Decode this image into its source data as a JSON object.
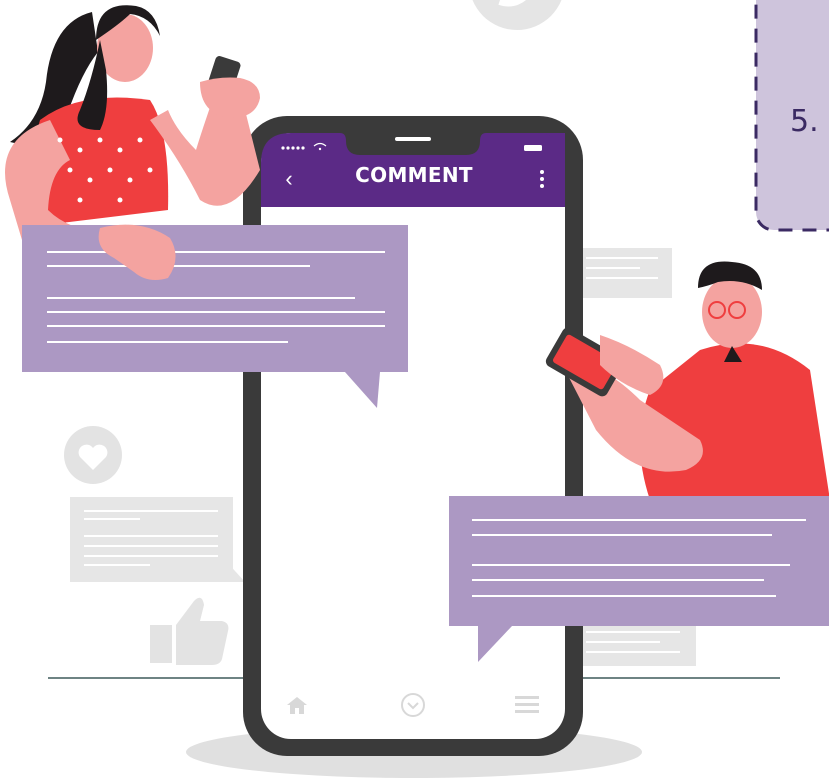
{
  "phone": {
    "header_title": "COMMENT",
    "back_icon": "chevron-left-icon",
    "menu_icon": "vertical-dots-icon",
    "bottom_nav": [
      "home-icon",
      "chevron-circle-icon",
      "hamburger-icon"
    ]
  },
  "step": {
    "label": "5."
  },
  "colors": {
    "header_purple": "#5b2a86",
    "bubble_purple": "#ac98c3",
    "phone_frame": "#3a3a3a",
    "shirt_red": "#ef3e3f",
    "skin": "#f4a3a0",
    "hair": "#1e1a1c",
    "gray_bubble": "#e6e6e6",
    "card_lilac": "#cec4dc"
  }
}
